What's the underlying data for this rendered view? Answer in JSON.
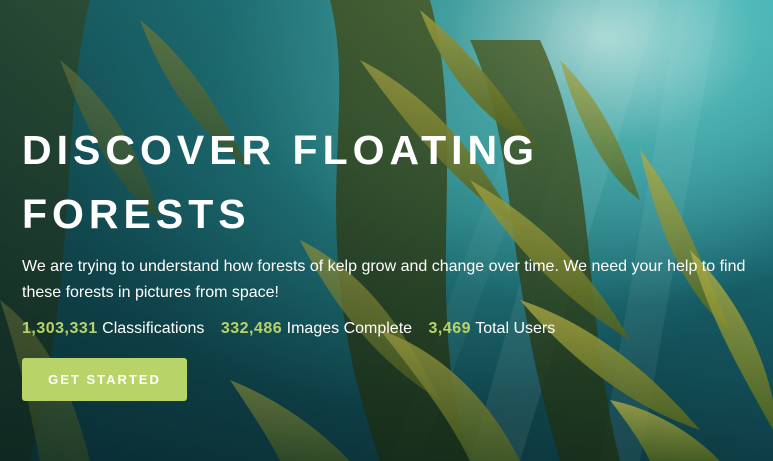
{
  "hero": {
    "title": "DISCOVER FLOATING FORESTS",
    "subtitle": "We are trying to understand how forests of kelp grow and change over time. We need your help to find these forests in pictures from space!",
    "stats": [
      {
        "value": "1,303,331",
        "label": "Classifications"
      },
      {
        "value": "332,486",
        "label": "Images Complete"
      },
      {
        "value": "3,469",
        "label": "Total Users"
      }
    ],
    "cta_label": "GET STARTED"
  },
  "colors": {
    "accent": "#b8d468",
    "stat_value": "#b9d36a",
    "text": "#ffffff",
    "water": "#1f7e86"
  }
}
